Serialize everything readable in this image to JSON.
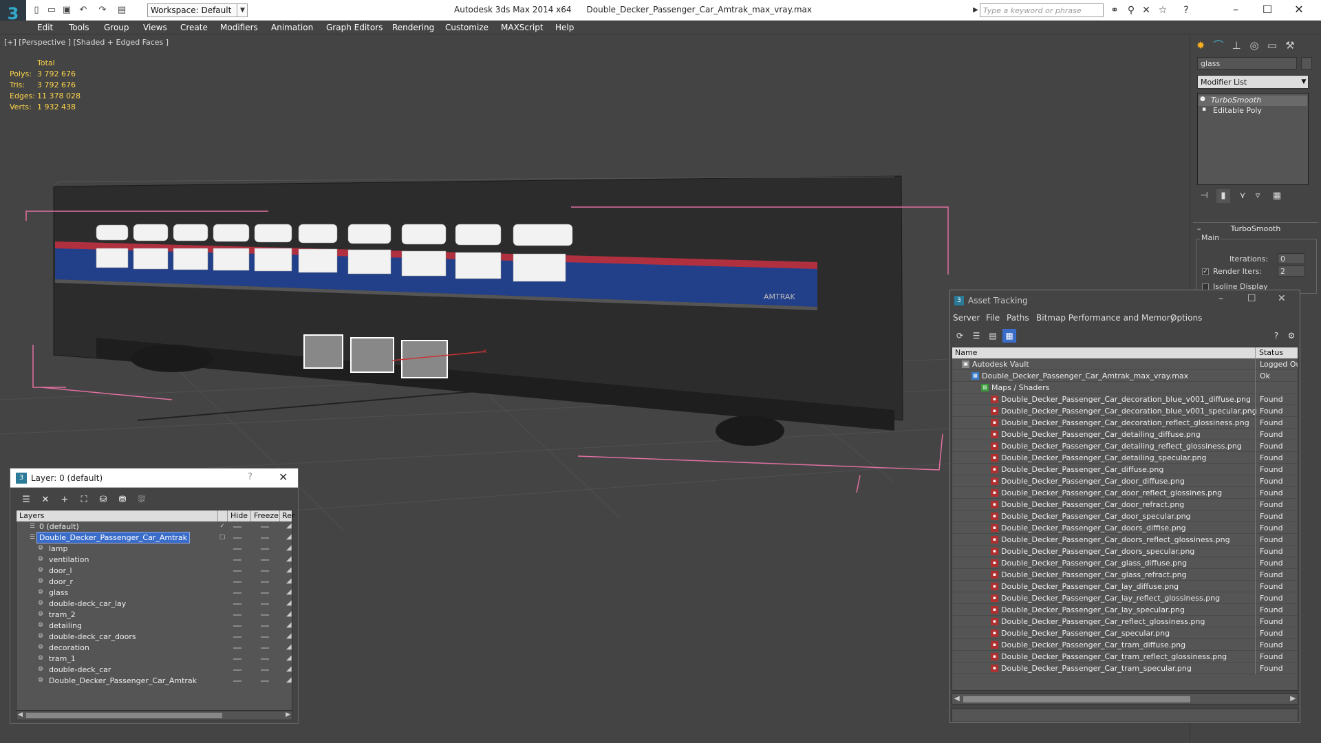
{
  "titlebar": {
    "app": "Autodesk 3ds Max  2014 x64",
    "file": "Double_Decker_Passenger_Car_Amtrak_max_vray.max",
    "workspace": "Workspace: Default",
    "search_placeholder": "Type a keyword or phrase"
  },
  "menu": [
    "Edit",
    "Tools",
    "Group",
    "Views",
    "Create",
    "Modifiers",
    "Animation",
    "Graph Editors",
    "Rendering",
    "Customize",
    "MAXScript",
    "Help"
  ],
  "viewport": {
    "label": "[+] [Perspective ] [Shaded + Edged Faces ]",
    "stats_header": "Total",
    "stats": [
      {
        "label": "Polys:",
        "value": "3 792 676"
      },
      {
        "label": "Tris:",
        "value": "3 792 676"
      },
      {
        "label": "Edges:",
        "value": "11 378 028"
      },
      {
        "label": "Verts:",
        "value": "1 932 438"
      }
    ],
    "decal_text": "AMTRAK"
  },
  "command_panel": {
    "object_name": "glass",
    "modifier_list": "Modifier List",
    "stack": [
      "TurboSmooth",
      "Editable Poly"
    ],
    "rollout": "TurboSmooth",
    "group": "Main",
    "iterations_label": "Iterations:",
    "iterations_value": "0",
    "render_iters_label": "Render Iters:",
    "render_iters_value": "2",
    "isoline_label": "Isoline Display"
  },
  "layer_window": {
    "title": "Layer: 0 (default)",
    "help": "?",
    "columns": {
      "layers": "Layers",
      "hide": "Hide",
      "freeze": "Freeze",
      "render": "Rer"
    },
    "rows": [
      {
        "name": "0 (default)",
        "level": 0
      },
      {
        "name": "Double_Decker_Passenger_Car_Amtrak",
        "level": 0
      },
      {
        "name": "lamp",
        "level": 1
      },
      {
        "name": "ventilation",
        "level": 1
      },
      {
        "name": "door_l",
        "level": 1
      },
      {
        "name": "door_r",
        "level": 1
      },
      {
        "name": "glass",
        "level": 1
      },
      {
        "name": "double-deck_car_lay",
        "level": 1
      },
      {
        "name": "tram_2",
        "level": 1
      },
      {
        "name": "detailing",
        "level": 1
      },
      {
        "name": "double-deck_car_doors",
        "level": 1
      },
      {
        "name": "decoration",
        "level": 1
      },
      {
        "name": "tram_1",
        "level": 1
      },
      {
        "name": "double-deck_car",
        "level": 1
      },
      {
        "name": "Double_Decker_Passenger_Car_Amtrak",
        "level": 1
      }
    ]
  },
  "asset_window": {
    "title": "Asset Tracking",
    "menu": [
      "Server",
      "File",
      "Paths",
      "Bitmap Performance and Memory",
      "Options"
    ],
    "columns": {
      "name": "Name",
      "status": "Status"
    },
    "rows": [
      {
        "name": "Autodesk Vault",
        "status": "Logged Ou",
        "level": 0,
        "kind": "vault"
      },
      {
        "name": "Double_Decker_Passenger_Car_Amtrak_max_vray.max",
        "status": "Ok",
        "level": 1,
        "kind": "max"
      },
      {
        "name": "Maps / Shaders",
        "status": "",
        "level": 2,
        "kind": "folder"
      },
      {
        "name": "Double_Decker_Passenger_Car_decoration_blue_v001_diffuse.png",
        "status": "Found",
        "level": 3,
        "kind": "png"
      },
      {
        "name": "Double_Decker_Passenger_Car_decoration_blue_v001_specular.png",
        "status": "Found",
        "level": 3,
        "kind": "png"
      },
      {
        "name": "Double_Decker_Passenger_Car_decoration_reflect_glossiness.png",
        "status": "Found",
        "level": 3,
        "kind": "png"
      },
      {
        "name": "Double_Decker_Passenger_Car_detailing_diffuse.png",
        "status": "Found",
        "level": 3,
        "kind": "png"
      },
      {
        "name": "Double_Decker_Passenger_Car_detailing_reflect_glossiness.png",
        "status": "Found",
        "level": 3,
        "kind": "png"
      },
      {
        "name": "Double_Decker_Passenger_Car_detailing_specular.png",
        "status": "Found",
        "level": 3,
        "kind": "png"
      },
      {
        "name": "Double_Decker_Passenger_Car_diffuse.png",
        "status": "Found",
        "level": 3,
        "kind": "png"
      },
      {
        "name": "Double_Decker_Passenger_Car_door_diffuse.png",
        "status": "Found",
        "level": 3,
        "kind": "png"
      },
      {
        "name": "Double_Decker_Passenger_Car_door_reflect_glossines.png",
        "status": "Found",
        "level": 3,
        "kind": "png"
      },
      {
        "name": "Double_Decker_Passenger_Car_door_refract.png",
        "status": "Found",
        "level": 3,
        "kind": "png"
      },
      {
        "name": "Double_Decker_Passenger_Car_door_specular.png",
        "status": "Found",
        "level": 3,
        "kind": "png"
      },
      {
        "name": "Double_Decker_Passenger_Car_doors_diffise.png",
        "status": "Found",
        "level": 3,
        "kind": "png"
      },
      {
        "name": "Double_Decker_Passenger_Car_doors_reflect_glossiness.png",
        "status": "Found",
        "level": 3,
        "kind": "png"
      },
      {
        "name": "Double_Decker_Passenger_Car_doors_specular.png",
        "status": "Found",
        "level": 3,
        "kind": "png"
      },
      {
        "name": "Double_Decker_Passenger_Car_glass_diffuse.png",
        "status": "Found",
        "level": 3,
        "kind": "png"
      },
      {
        "name": "Double_Decker_Passenger_Car_glass_refract.png",
        "status": "Found",
        "level": 3,
        "kind": "png"
      },
      {
        "name": "Double_Decker_Passenger_Car_lay_diffuse.png",
        "status": "Found",
        "level": 3,
        "kind": "png"
      },
      {
        "name": "Double_Decker_Passenger_Car_lay_reflect_glossiness.png",
        "status": "Found",
        "level": 3,
        "kind": "png"
      },
      {
        "name": "Double_Decker_Passenger_Car_lay_specular.png",
        "status": "Found",
        "level": 3,
        "kind": "png"
      },
      {
        "name": "Double_Decker_Passenger_Car_reflect_glossiness.png",
        "status": "Found",
        "level": 3,
        "kind": "png"
      },
      {
        "name": "Double_Decker_Passenger_Car_specular.png",
        "status": "Found",
        "level": 3,
        "kind": "png"
      },
      {
        "name": "Double_Decker_Passenger_Car_tram_diffuse.png",
        "status": "Found",
        "level": 3,
        "kind": "png"
      },
      {
        "name": "Double_Decker_Passenger_Car_tram_reflect_glossiness.png",
        "status": "Found",
        "level": 3,
        "kind": "png"
      },
      {
        "name": "Double_Decker_Passenger_Car_tram_specular.png",
        "status": "Found",
        "level": 3,
        "kind": "png"
      }
    ]
  },
  "colors": {
    "accent": "#3a6cc9",
    "stats": "#ffd54a",
    "selection_box": "#e070a0",
    "amtrak_blue": "#223f8a",
    "amtrak_red": "#b03040"
  }
}
